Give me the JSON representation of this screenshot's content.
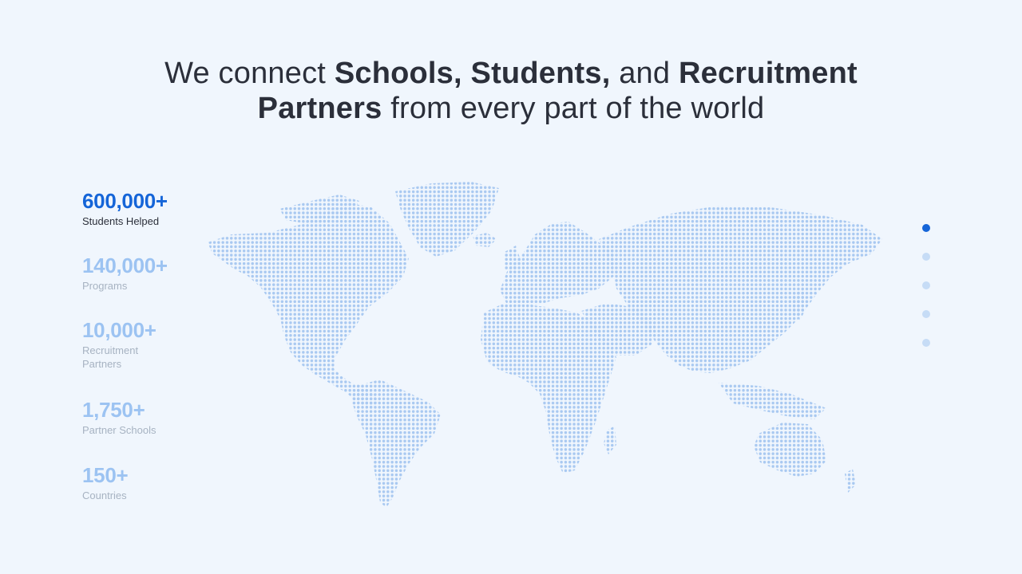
{
  "headline": {
    "part1": "We connect ",
    "bold1": "Schools, Students,",
    "part2": " and ",
    "bold2": "Recruitment",
    "bold3": "Partners",
    "part3": " from every part of the world"
  },
  "stats": [
    {
      "value": "600,000+",
      "label": "Students Helped",
      "active": true
    },
    {
      "value": "140,000+",
      "label": "Programs",
      "active": false
    },
    {
      "value": "10,000+",
      "label": "Recruitment Partners",
      "active": false
    },
    {
      "value": "1,750+",
      "label": "Partner Schools",
      "active": false
    },
    {
      "value": "150+",
      "label": "Countries",
      "active": false
    }
  ],
  "carousel": {
    "count": 5,
    "active_index": 0
  },
  "colors": {
    "accent": "#1565d8",
    "accent_light": "#9cc3f2",
    "map_dot": "#a9c9f1",
    "background": "#f0f6fd",
    "heading": "#2b2f3a"
  },
  "map": {
    "icon": "world-map-dotted-icon"
  }
}
